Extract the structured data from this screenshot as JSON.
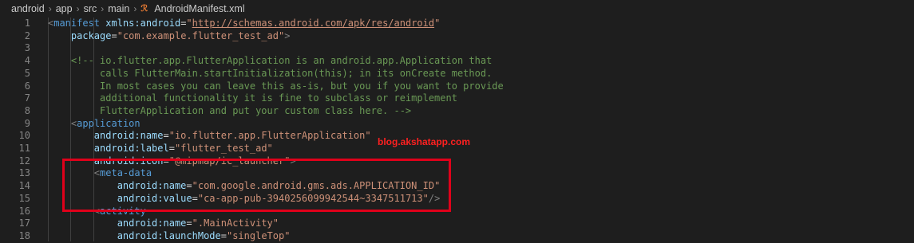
{
  "breadcrumb": {
    "items": [
      "android",
      "app",
      "src",
      "main"
    ],
    "file": "AndroidManifest.xml",
    "file_icon": "rss-xml-icon"
  },
  "editor": {
    "lines": [
      {
        "n": "1",
        "parts": [
          [
            "punct",
            "<"
          ],
          [
            "tag",
            "manifest"
          ],
          [
            "plain",
            " "
          ],
          [
            "attr",
            "xmlns:android"
          ],
          [
            "plain",
            "="
          ],
          [
            "str",
            "\""
          ],
          [
            "url",
            "http://schemas.android.com/apk/res/android"
          ],
          [
            "str",
            "\""
          ]
        ]
      },
      {
        "n": "2",
        "parts": [
          [
            "plain",
            "    "
          ],
          [
            "attr",
            "package"
          ],
          [
            "plain",
            "="
          ],
          [
            "str",
            "\"com.example.flutter_test_ad\""
          ],
          [
            "punct",
            ">"
          ]
        ]
      },
      {
        "n": "3",
        "parts": []
      },
      {
        "n": "4",
        "parts": [
          [
            "plain",
            "    "
          ],
          [
            "comment",
            "<!-- io.flutter.app.FlutterApplication is an android.app.Application that"
          ]
        ]
      },
      {
        "n": "5",
        "parts": [
          [
            "comment",
            "         calls FlutterMain.startInitialization(this); in its onCreate method."
          ]
        ]
      },
      {
        "n": "6",
        "parts": [
          [
            "comment",
            "         In most cases you can leave this as-is, but you if you want to provide"
          ]
        ]
      },
      {
        "n": "7",
        "parts": [
          [
            "comment",
            "         additional functionality it is fine to subclass or reimplement"
          ]
        ]
      },
      {
        "n": "8",
        "parts": [
          [
            "comment",
            "         FlutterApplication and put your custom class here. -->"
          ]
        ]
      },
      {
        "n": "9",
        "parts": [
          [
            "plain",
            "    "
          ],
          [
            "punct",
            "<"
          ],
          [
            "tag",
            "application"
          ]
        ]
      },
      {
        "n": "10",
        "parts": [
          [
            "plain",
            "        "
          ],
          [
            "attr",
            "android:name"
          ],
          [
            "plain",
            "="
          ],
          [
            "str",
            "\"io.flutter.app.FlutterApplication\""
          ]
        ]
      },
      {
        "n": "11",
        "parts": [
          [
            "plain",
            "        "
          ],
          [
            "attr",
            "android:label"
          ],
          [
            "plain",
            "="
          ],
          [
            "str",
            "\"flutter_test_ad\""
          ]
        ]
      },
      {
        "n": "12",
        "parts": [
          [
            "plain",
            "        "
          ],
          [
            "attr",
            "android:icon"
          ],
          [
            "plain",
            "="
          ],
          [
            "str",
            "\"@mipmap/ic_launcher\""
          ],
          [
            "punct",
            ">"
          ]
        ]
      },
      {
        "n": "13",
        "parts": [
          [
            "plain",
            "        "
          ],
          [
            "punct",
            "<"
          ],
          [
            "tag",
            "meta-data"
          ]
        ]
      },
      {
        "n": "14",
        "parts": [
          [
            "plain",
            "            "
          ],
          [
            "attr",
            "android:name"
          ],
          [
            "plain",
            "="
          ],
          [
            "str",
            "\"com.google.android.gms.ads.APPLICATION_ID\""
          ]
        ]
      },
      {
        "n": "15",
        "parts": [
          [
            "plain",
            "            "
          ],
          [
            "attr",
            "android:value"
          ],
          [
            "plain",
            "="
          ],
          [
            "str",
            "\"ca-app-pub-3940256099942544~3347511713\""
          ],
          [
            "punct",
            "/>"
          ]
        ]
      },
      {
        "n": "16",
        "parts": [
          [
            "plain",
            "        "
          ],
          [
            "punct",
            "<"
          ],
          [
            "tag",
            "activity"
          ]
        ]
      },
      {
        "n": "17",
        "parts": [
          [
            "plain",
            "            "
          ],
          [
            "attr",
            "android:name"
          ],
          [
            "plain",
            "="
          ],
          [
            "str",
            "\".MainActivity\""
          ]
        ]
      },
      {
        "n": "18",
        "parts": [
          [
            "plain",
            "            "
          ],
          [
            "attr",
            "android:launchMode"
          ],
          [
            "plain",
            "="
          ],
          [
            "str",
            "\"singleTop\""
          ]
        ]
      }
    ]
  },
  "watermark": "blog.akshatapp.com",
  "colors": {
    "background": "#1e1e1e",
    "tag": "#569cd6",
    "attribute": "#9cdcfe",
    "string": "#ce9178",
    "comment": "#6a9955",
    "highlight_box": "#e0001a",
    "watermark": "#ff2020"
  }
}
